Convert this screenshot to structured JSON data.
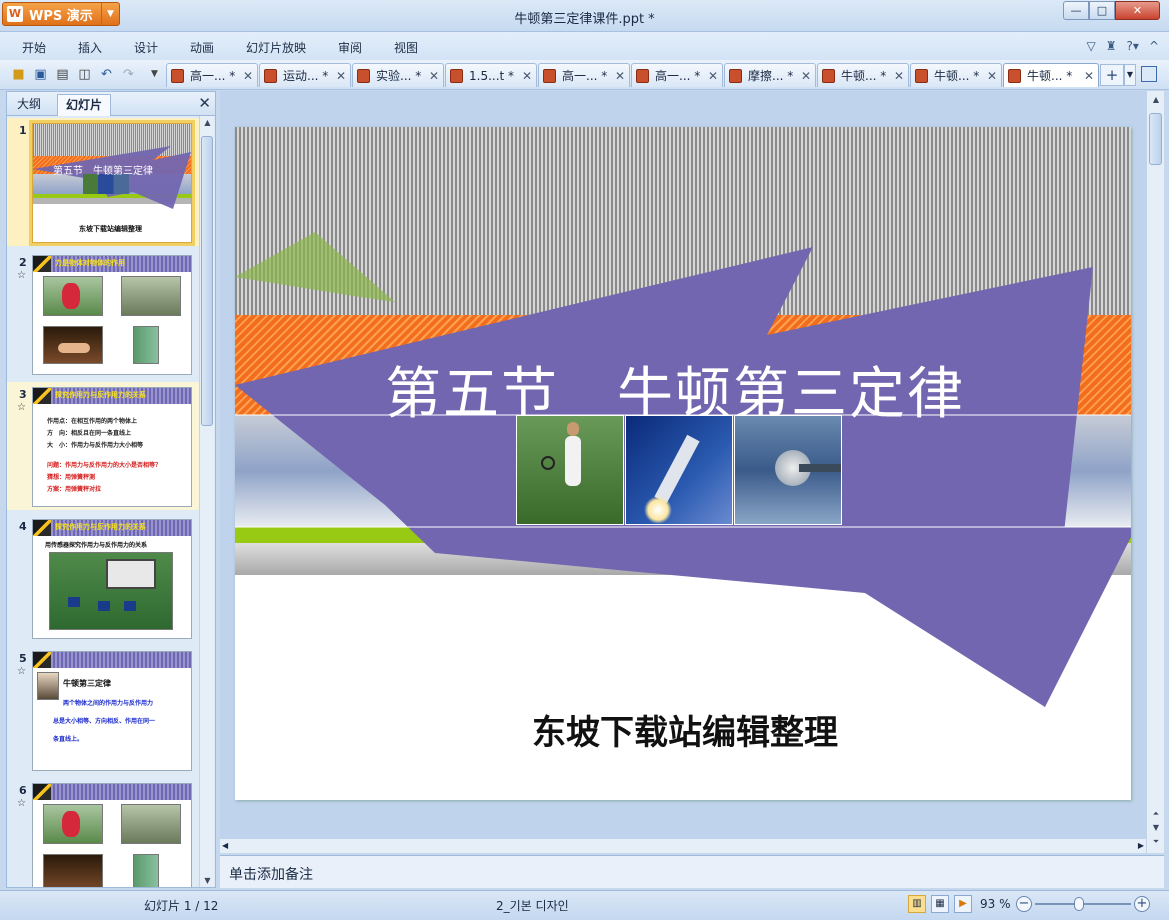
{
  "window": {
    "app_button": "WPS 演示",
    "title": "牛顿第三定律课件.ppt *",
    "min": "—",
    "max": "□",
    "close": "✕"
  },
  "menu": {
    "items": [
      "开始",
      "插入",
      "设计",
      "动画",
      "幻灯片放映",
      "审阅",
      "视图"
    ]
  },
  "toolbar": {
    "tabs": [
      {
        "label": "高一... *"
      },
      {
        "label": "运动... *"
      },
      {
        "label": "实验... *"
      },
      {
        "label": "1.5...t *"
      },
      {
        "label": "高一... *"
      },
      {
        "label": "高一... *"
      },
      {
        "label": "摩擦... *"
      },
      {
        "label": "牛顿... *"
      },
      {
        "label": "牛顿... *"
      },
      {
        "label": "牛顿... *"
      }
    ],
    "active_tab_index": 9
  },
  "panel": {
    "tab_outline": "大纲",
    "tab_slides": "幻灯片",
    "thumbnails": [
      {
        "num": "1",
        "star": "",
        "title": "第五节　牛顿第三定律",
        "subtitle": "东坡下载站编辑整理"
      },
      {
        "num": "2",
        "star": "☆",
        "title": "力是物体对物体的作用"
      },
      {
        "num": "3",
        "star": "☆",
        "title": "探究作用力与反作用力的关系",
        "lines": [
          "作用点：在相互作用的两个物体上",
          "方　向：相反且在同一条直线上",
          "大　小：作用力与反作用力大小相等",
          "问题：作用力与反作用力的大小是否相等？",
          "猜想：用弹簧秤测",
          "方案：用弹簧秤对拉"
        ]
      },
      {
        "num": "4",
        "star": "",
        "title": "探究作用力与反作用力的关系",
        "caption": "用传感器探究作用力与反作用力的关系"
      },
      {
        "num": "5",
        "star": "☆",
        "title": "牛顿第三定律",
        "lines": [
          "两个物体之间的作用力与反作用力",
          "总是大小相等、方向相反、作用在同一",
          "条直线上。"
        ]
      },
      {
        "num": "6",
        "star": "☆",
        "title": ""
      }
    ]
  },
  "slide": {
    "title": "第五节　牛顿第三定律",
    "subtitle": "东坡下载站编辑整理"
  },
  "notes": {
    "placeholder": "单击添加备注"
  },
  "status": {
    "slide_count": "幻灯片 1 / 12",
    "theme": "2_기본 디자인",
    "zoom": "93 %",
    "zoom_value": 93
  }
}
